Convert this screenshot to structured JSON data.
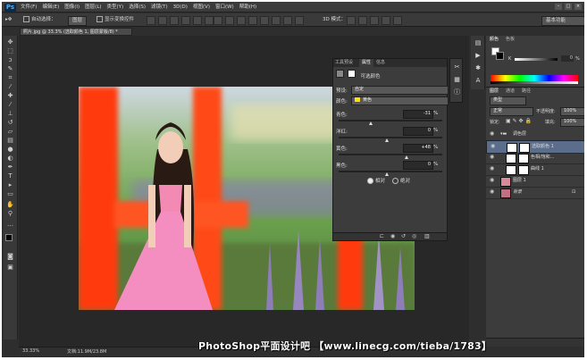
{
  "app": {
    "logo": "Ps"
  },
  "menu": [
    "文件(F)",
    "编辑(E)",
    "图像(I)",
    "图层(L)",
    "类型(Y)",
    "选择(S)",
    "滤镜(T)",
    "3D(D)",
    "视图(V)",
    "窗口(W)",
    "帮助(H)"
  ],
  "window_buttons": [
    "–",
    "□",
    "×"
  ],
  "options": {
    "auto_select_label": "自动选择：",
    "auto_select_value": "图层",
    "show_transform_label": "显示变换控件",
    "mode_3d_label": "3D 模式：",
    "workspace": "基本功能"
  },
  "document": {
    "tab_title": "照片.jpg @ 33.3% (选取颜色 1, 图层蒙版/8) *",
    "zoom": "33.33%",
    "doc_info": "文档:11.9M/23.8M"
  },
  "properties": {
    "tabs": [
      "工具预设",
      "属性",
      "信息"
    ],
    "active_tab": "属性",
    "title": "可选颜色",
    "preset_label": "预设:",
    "preset_value": "自定",
    "color_label": "颜色:",
    "color_value": "黄色",
    "color_swatch": "#ffe000",
    "sliders": [
      {
        "label": "青色:",
        "value": "-31",
        "unit": "%"
      },
      {
        "label": "洋红:",
        "value": "0",
        "unit": "%"
      },
      {
        "label": "黄色:",
        "value": "+48",
        "unit": "%"
      },
      {
        "label": "黑色:",
        "value": "0",
        "unit": "%"
      }
    ],
    "method_relative": "相对",
    "method_absolute": "绝对",
    "method_selected": "相对"
  },
  "color_panel": {
    "tabs": [
      "颜色",
      "色板"
    ],
    "k_label": "K",
    "k_value": "0",
    "k_unit": "%"
  },
  "layers_panel": {
    "tabs": [
      "图层",
      "通道",
      "路径"
    ],
    "kind_label": "类型",
    "blend_mode": "正常",
    "opacity_label": "不透明度:",
    "opacity": "100%",
    "lock_label": "锁定:",
    "fill_label": "填充:",
    "fill": "100%",
    "layers": [
      {
        "name": "调色层",
        "kind": "group",
        "selected": false
      },
      {
        "name": "选取颜色 1",
        "kind": "adjustment",
        "selected": true
      },
      {
        "name": "色相/饱和...",
        "kind": "adjustment",
        "selected": false
      },
      {
        "name": "曲线 1",
        "kind": "adjustment",
        "selected": false
      },
      {
        "name": "图层 1",
        "kind": "pixel",
        "selected": false
      },
      {
        "name": "背景",
        "kind": "background",
        "selected": false
      }
    ]
  },
  "watermark": "PhotoShop平面设计吧 【www.linecg.com/tieba/1783】"
}
